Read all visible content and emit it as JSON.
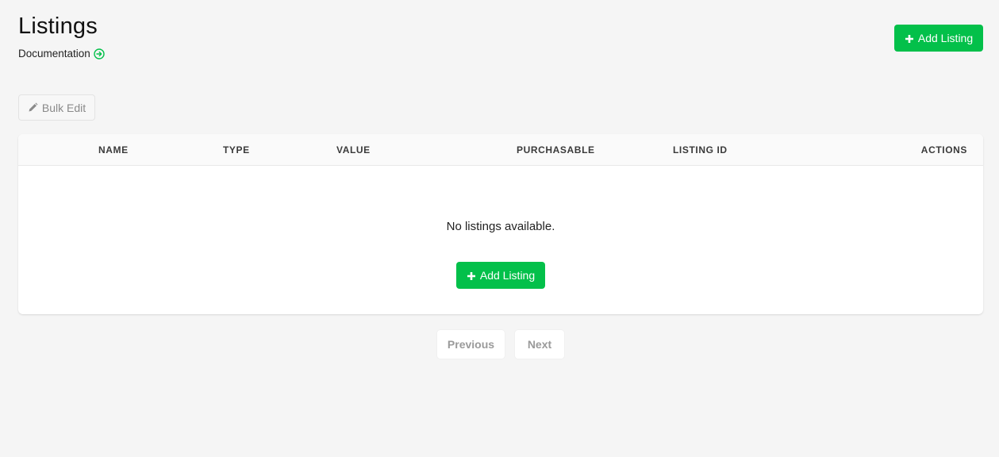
{
  "header": {
    "title": "Listings",
    "doc_link": "Documentation",
    "add_listing_label": "Add Listing"
  },
  "toolbar": {
    "bulk_edit_label": "Bulk Edit"
  },
  "table": {
    "columns": [
      "NAME",
      "TYPE",
      "VALUE",
      "PURCHASABLE",
      "LISTING ID",
      "ACTIONS"
    ],
    "empty_message": "No listings available.",
    "empty_add_label": "Add Listing"
  },
  "pagination": {
    "previous_label": "Previous",
    "next_label": "Next"
  },
  "colors": {
    "accent_green": "#03c04a",
    "background": "#f5f5f5"
  },
  "icons": {
    "doc_link_icon": "circle-arrow-right-icon",
    "add_icon": "plus-icon",
    "bulk_edit_icon": "pencil-icon"
  }
}
